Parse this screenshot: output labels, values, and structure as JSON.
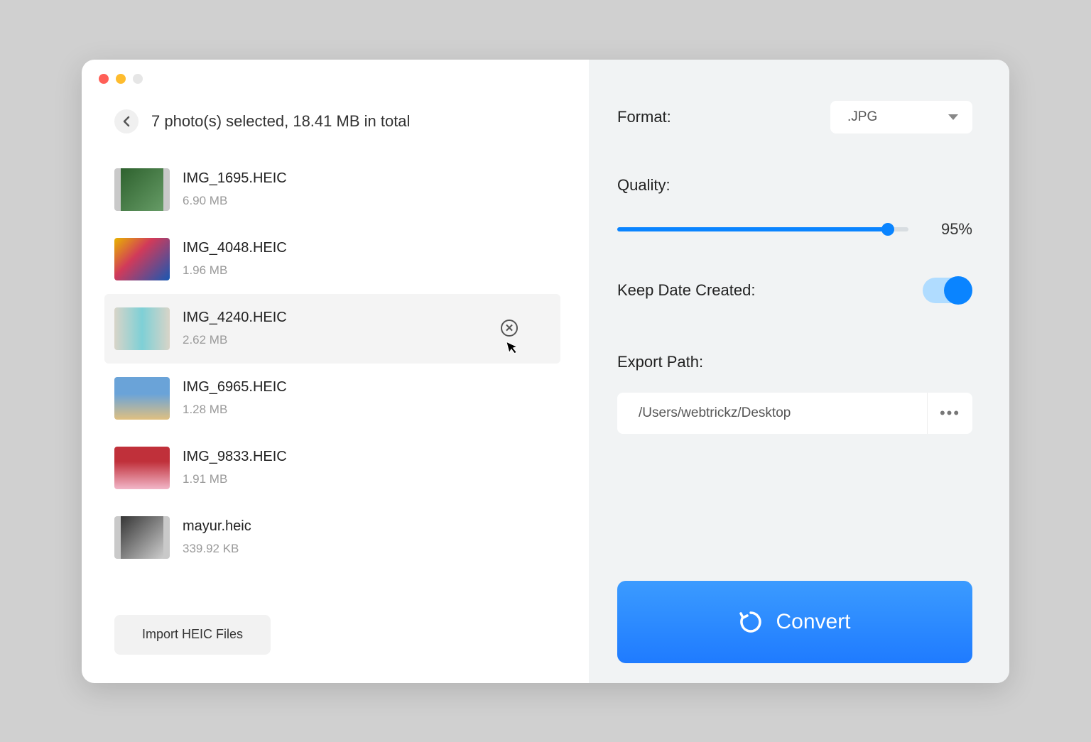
{
  "header": {
    "summary": "7 photo(s) selected, 18.41 MB in total"
  },
  "files": [
    {
      "name": "IMG_1695.HEIC",
      "size": "6.90 MB"
    },
    {
      "name": "IMG_4048.HEIC",
      "size": "1.96 MB"
    },
    {
      "name": "IMG_4240.HEIC",
      "size": "2.62 MB"
    },
    {
      "name": "IMG_6965.HEIC",
      "size": "1.28 MB"
    },
    {
      "name": "IMG_9833.HEIC",
      "size": "1.91 MB"
    },
    {
      "name": "mayur.heic",
      "size": "339.92 KB"
    }
  ],
  "import_label": "Import HEIC Files",
  "settings": {
    "format_label": "Format:",
    "format_value": ".JPG",
    "quality_label": "Quality:",
    "quality_value": "95%",
    "keep_date_label": "Keep Date Created:",
    "keep_date_on": true,
    "export_path_label": "Export Path:",
    "export_path_value": "/Users/webtrickz/Desktop"
  },
  "convert_label": "Convert"
}
